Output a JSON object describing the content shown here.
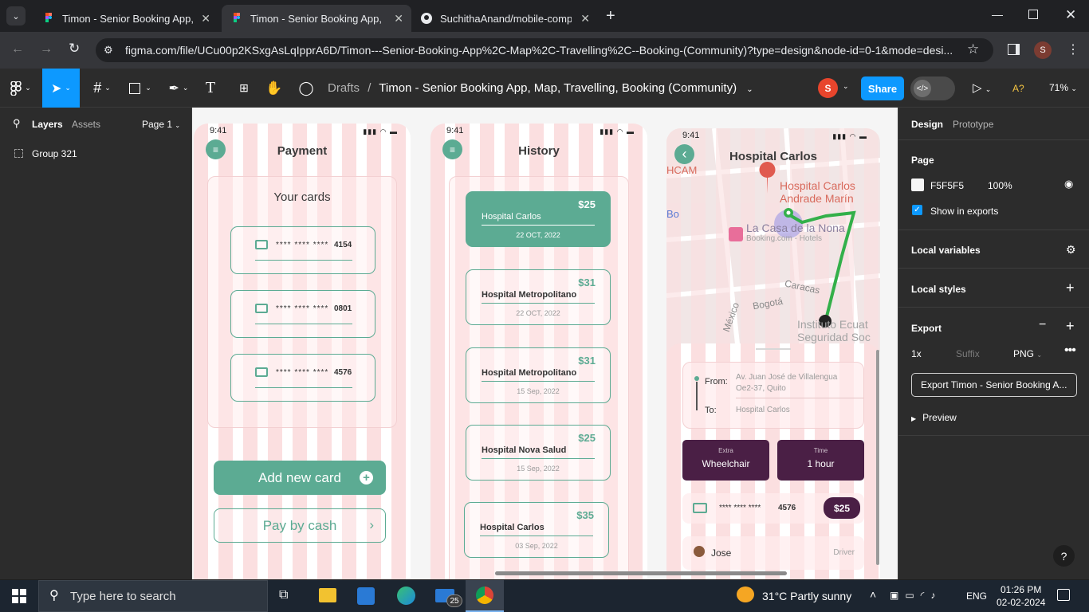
{
  "browser": {
    "tabs": [
      {
        "title": "Timon - Senior Booking App, M"
      },
      {
        "title": "Timon - Senior Booking App, M"
      },
      {
        "title": "SuchithaAnand/mobile-comput"
      }
    ],
    "url": "figma.com/file/UCu00p2KSxgAsLqIpprA6D/Timon---Senior-Booking-App%2C-Map%2C-Travelling%2C--Booking-(Community)?type=design&node-id=0-1&mode=desi..."
  },
  "figma": {
    "breadcrumb_root": "Drafts",
    "breadcrumb_sep": "/",
    "file_title": "Timon - Senior Booking App, Map, Travelling, Booking (Community)",
    "avatar_letter": "S",
    "share_label": "Share",
    "zoom": "71%",
    "font_warning": "A?"
  },
  "left_panel": {
    "tab_layers": "Layers",
    "tab_assets": "Assets",
    "page_selector": "Page 1",
    "layers": [
      "Group 321"
    ]
  },
  "right_panel": {
    "tab_design": "Design",
    "tab_prototype": "Prototype",
    "page_heading": "Page",
    "page_color": "F5F5F5",
    "page_opacity": "100%",
    "show_in_exports": "Show in exports",
    "local_variables": "Local variables",
    "local_styles": "Local styles",
    "export_heading": "Export",
    "export_scale": "1x",
    "export_suffix_placeholder": "Suffix",
    "export_format": "PNG",
    "export_button": "Export Timon - Senior Booking A...",
    "preview": "Preview",
    "help": "?"
  },
  "screens": {
    "payment": {
      "time": "9:41",
      "title": "Payment",
      "cards_title": "Your cards",
      "cards": [
        {
          "mask": "****  ****  ****",
          "last4": "4154"
        },
        {
          "mask": "****  ****  ****",
          "last4": "0801"
        },
        {
          "mask": "****  ****  ****",
          "last4": "4576"
        }
      ],
      "add_card": "Add new card",
      "pay_cash": "Pay by cash"
    },
    "history": {
      "time": "9:41",
      "title": "History",
      "items": [
        {
          "price": "$25",
          "name": "Hospital Carlos",
          "date": "22 OCT, 2022"
        },
        {
          "price": "$31",
          "name": "Hospital Metropolitano",
          "date": "22 OCT, 2022"
        },
        {
          "price": "$31",
          "name": "Hospital Metropolitano",
          "date": "15 Sep, 2022"
        },
        {
          "price": "$25",
          "name": "Hospital Nova Salud",
          "date": "15 Sep, 2022"
        },
        {
          "price": "$35",
          "name": "Hospital Carlos",
          "date": "03 Sep, 2022"
        }
      ]
    },
    "map": {
      "time": "9:41",
      "title": "Hospital Carlos",
      "map_labels": {
        "hospital": "Hospital Carlos",
        "hospital2": "Andrade Marín",
        "hotel": "La Casa de la Nona",
        "hotel_sub": "Booking.com - Hotels",
        "street1": "Caracas",
        "street2": "Bogotá",
        "street3": "México",
        "inst1": "Instituto Ecuat",
        "inst2": "Seguridad Soc",
        "hcam": "HCAM",
        "bo": "Bo"
      },
      "from_label": "From:",
      "from_value_1": "Av. Juan José de Villalengua",
      "from_value_2": "Oe2-37, Quito",
      "to_label": "To:",
      "to_value": "Hospital Carlos",
      "extra_label": "Extra",
      "extra_value": "Wheelchair",
      "time_label": "Time",
      "time_value": "1 hour",
      "card_mask": "****  ****  ****",
      "card_last4": "4576",
      "price": "$25",
      "driver_name": "Jose",
      "driver_label": "Driver"
    }
  },
  "taskbar": {
    "search_placeholder": "Type here to search",
    "mail_badge": "25",
    "weather": "31°C  Partly sunny",
    "lang": "ENG",
    "time": "01:26 PM",
    "date": "02-02-2024"
  },
  "colors": {
    "accent_green": "#5cab93",
    "dark_purple": "#4a1f45",
    "figma_blue": "#0d99ff",
    "stripe_pink": "#fbdfe0"
  }
}
